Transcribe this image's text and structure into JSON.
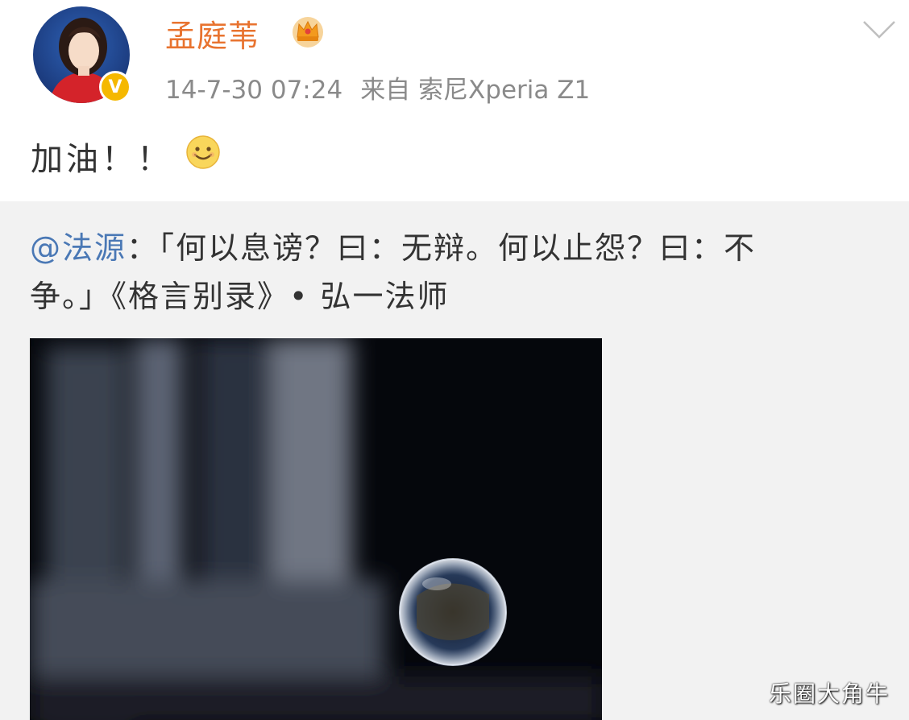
{
  "post": {
    "username": "孟庭苇",
    "verified_mark": "V",
    "timestamp": "14-7-30 07:24",
    "source": "来自 索尼Xperia Z1",
    "text": "加油！！"
  },
  "repost": {
    "mention": "@法源",
    "text_line1": "：「何以息谤？曰：无辩。何以止怨？曰：不",
    "text_line2": "争。」《格言别录》• 弘一法师"
  },
  "watermark": "乐圈大角牛",
  "colors": {
    "username": "#e8732f",
    "mention": "#4a78b5",
    "verified": "#f5b800",
    "meta": "#8a8a8a"
  },
  "icons": [
    "chevron-down-icon",
    "crown-icon",
    "verified-icon",
    "smile-icon"
  ]
}
